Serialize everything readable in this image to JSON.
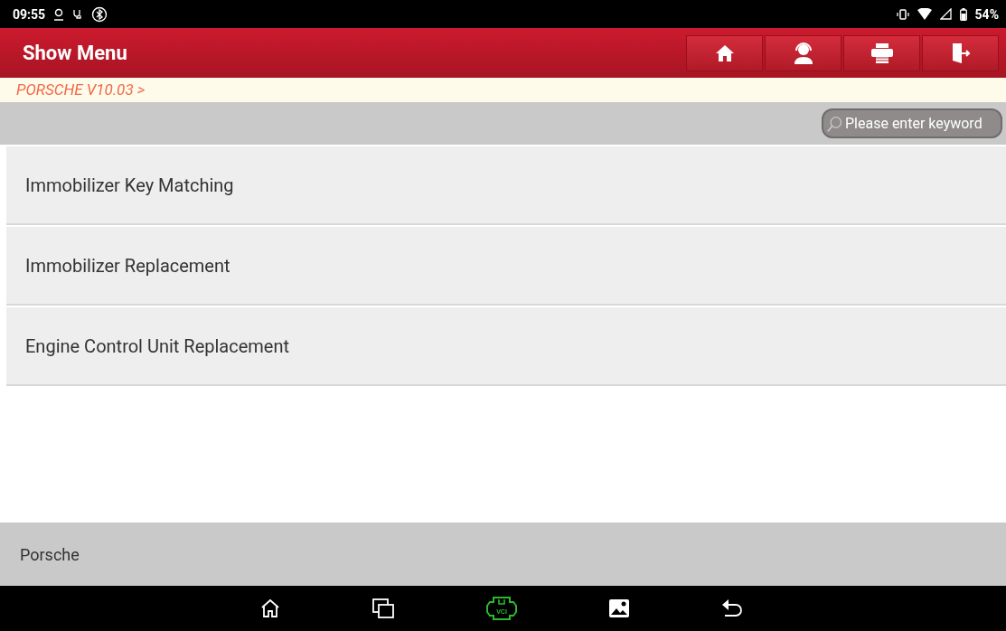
{
  "status_bar": {
    "time": "09:55",
    "battery": "54%"
  },
  "header": {
    "title": "Show Menu"
  },
  "breadcrumb": "PORSCHE V10.03 >",
  "search": {
    "placeholder": "Please enter keyword"
  },
  "menu_items": [
    {
      "label": "Immobilizer Key Matching"
    },
    {
      "label": "Immobilizer Replacement"
    },
    {
      "label": "Engine Control Unit Replacement"
    }
  ],
  "footer": {
    "label": "Porsche"
  },
  "nav_bar": {
    "vci_label": "VCI"
  }
}
